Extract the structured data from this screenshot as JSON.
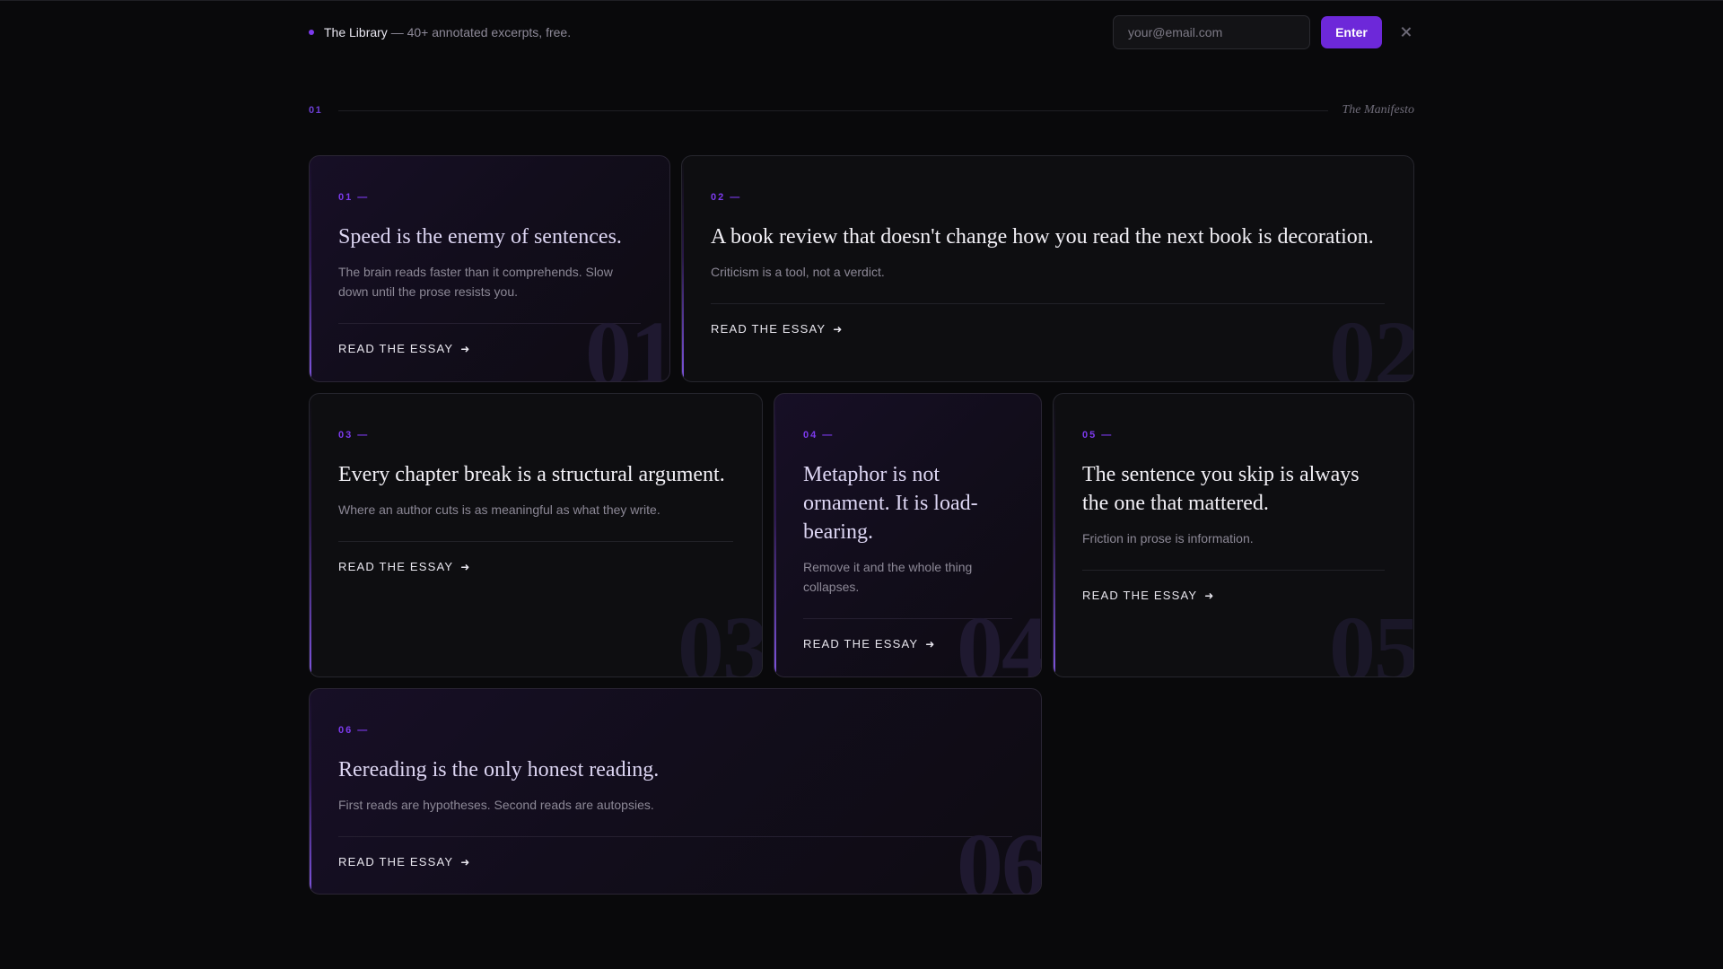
{
  "banner": {
    "brand": "The Library",
    "tagline": " — 40+ annotated excerpts, free.",
    "email_placeholder": "your@email.com",
    "enter_label": "Enter",
    "close_icon": "close-icon"
  },
  "section": {
    "number": "01",
    "title": "The Manifesto"
  },
  "cards": [
    {
      "num": "01 —",
      "title": "Speed is the enemy of sentences.",
      "desc": "The brain reads faster than it comprehends. Slow down until the prose resists you.",
      "link": "READ THE ESSAY",
      "arrow": "➜",
      "bg_num": "01"
    },
    {
      "num": "02 —",
      "title": "A book review that doesn't change how you read the next book is decoration.",
      "desc": "Criticism is a tool, not a verdict.",
      "link": "READ THE ESSAY",
      "arrow": "➜",
      "bg_num": "02"
    },
    {
      "num": "03 —",
      "title": "Every chapter break is a structural argument.",
      "desc": "Where an author cuts is as meaningful as what they write.",
      "link": "READ THE ESSAY",
      "arrow": "➜",
      "bg_num": "03"
    },
    {
      "num": "04 —",
      "title": "Metaphor is not ornament. It is load-bearing.",
      "desc": "Remove it and the whole thing collapses.",
      "link": "READ THE ESSAY",
      "arrow": "➜",
      "bg_num": "04"
    },
    {
      "num": "05 —",
      "title": "The sentence you skip is always the one that mattered.",
      "desc": "Friction in prose is information.",
      "link": "READ THE ESSAY",
      "arrow": "➜",
      "bg_num": "05"
    },
    {
      "num": "06 —",
      "title": "Rereading is the only honest reading.",
      "desc": "First reads are hypotheses. Second reads are autopsies.",
      "link": "READ THE ESSAY",
      "arrow": "➜",
      "bg_num": "06"
    }
  ],
  "colors": {
    "background": "#09090b",
    "accent": "#7c3aed",
    "button": "#6d28d9"
  }
}
